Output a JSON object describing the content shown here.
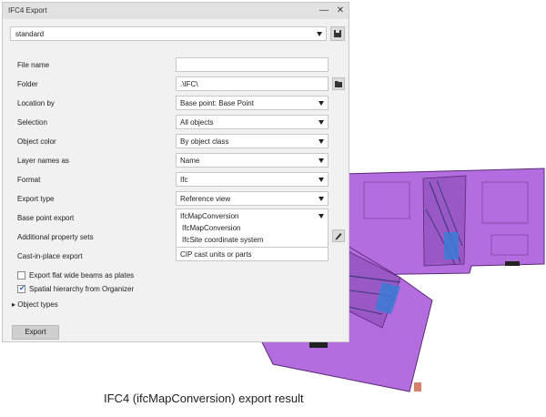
{
  "window": {
    "title": "IFC4 Export"
  },
  "preset": {
    "value": "standard"
  },
  "fields": [
    {
      "label": "File name",
      "value": ""
    },
    {
      "label": "Folder",
      "value": ".\\IFC\\"
    },
    {
      "label": "Location by",
      "value": "Base point: Base Point"
    },
    {
      "label": "Selection",
      "value": "All objects"
    },
    {
      "label": "Object color",
      "value": "By object class"
    },
    {
      "label": "Layer names as",
      "value": "Name"
    },
    {
      "label": "Format",
      "value": "Ifc"
    },
    {
      "label": "Export type",
      "value": "Reference view"
    },
    {
      "label": "Base point export",
      "value": "IfcMapConversion"
    },
    {
      "label": "Additional property sets",
      "value": ""
    },
    {
      "label": "Cast-in-place export",
      "value": "CIP cast units or parts"
    }
  ],
  "base_point_options": [
    "IfcMapConversion",
    "IfcSite coordinate system"
  ],
  "checkboxes": [
    {
      "label": "Export flat wide beams as plates",
      "checked": false
    },
    {
      "label": "Spatial hierarchy from Organizer",
      "checked": true
    }
  ],
  "object_types": {
    "label": "Object types"
  },
  "export_button": {
    "label": "Export"
  },
  "caption": "IFC4 (ifcMapConversion) export result",
  "colors": {
    "model": "#b66fe0",
    "model_edge": "#5a2a78",
    "accent": "#3a7bd5"
  },
  "icons": {
    "save": "floppy-disk-icon",
    "folder": "folder-icon",
    "edit": "pencil-icon",
    "close": "close-icon",
    "minimize": "minimize-icon"
  }
}
